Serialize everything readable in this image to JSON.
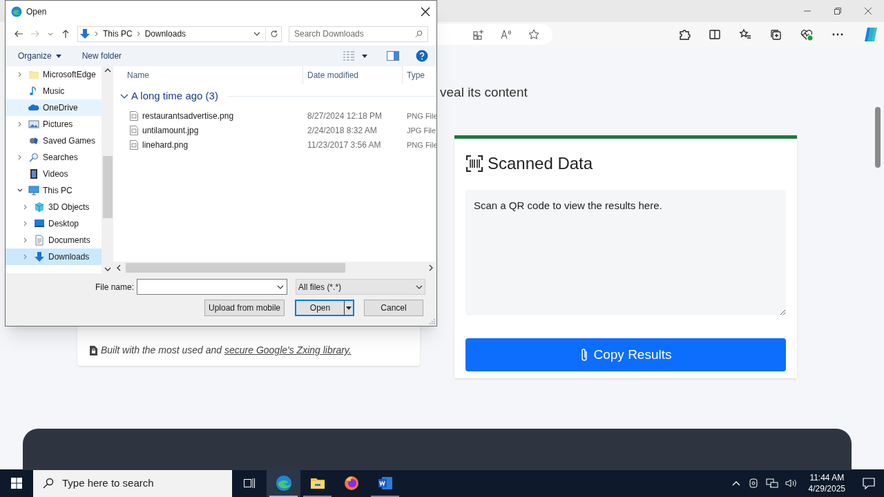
{
  "page": {
    "heading_fragment": "veal its content",
    "footer_note": {
      "text": "Built with the most used and ",
      "link": "secure Google's Zxing library."
    },
    "scanned_card": {
      "title": "Scanned Data",
      "results": {
        "placeholder": "Scan a QR code to view the results here."
      },
      "button": "Copy Results"
    }
  },
  "dialog": {
    "title": "Open",
    "address": [
      "This PC",
      "Downloads"
    ],
    "search": {
      "placeholder": "Search Downloads"
    },
    "toolbar": [
      "Organize",
      "New folder"
    ],
    "nav": [
      {
        "label": "MicrosoftEdge",
        "kind": "folder",
        "expandable": true,
        "selected": false,
        "hovered": false
      },
      {
        "label": "Music",
        "kind": "music",
        "expandable": false,
        "selected": false,
        "hovered": false
      },
      {
        "label": "OneDrive",
        "kind": "cloud",
        "expandable": false,
        "selected": false,
        "hovered": true
      },
      {
        "label": "Pictures",
        "kind": "pictures",
        "expandable": true,
        "selected": false,
        "hovered": false
      },
      {
        "label": "Saved Games",
        "kind": "games",
        "expandable": false,
        "selected": false,
        "hovered": false
      },
      {
        "label": "Searches",
        "kind": "search",
        "expandable": true,
        "selected": false,
        "hovered": false
      },
      {
        "label": "Videos",
        "kind": "videos",
        "expandable": false,
        "selected": false,
        "hovered": false
      },
      {
        "label": "This PC",
        "kind": "pc",
        "expandable": true,
        "expanded": true,
        "selected": false,
        "hovered": false,
        "children": [
          {
            "label": "3D Objects",
            "kind": "cube",
            "expandable": true,
            "selected": false,
            "hovered": false
          },
          {
            "label": "Desktop",
            "kind": "desktop",
            "expandable": true,
            "selected": false,
            "hovered": false
          },
          {
            "label": "Documents",
            "kind": "documents",
            "expandable": true,
            "selected": false,
            "hovered": false
          },
          {
            "label": "Downloads",
            "kind": "downloads",
            "expandable": true,
            "selected": true,
            "hovered": false
          }
        ]
      }
    ],
    "columns": [
      "Name",
      "Date modified",
      "Type"
    ],
    "group": {
      "label": "A long time ago (3)",
      "expanded": true
    },
    "files": [
      {
        "name": "restaurantsadvertise.png",
        "date": "8/27/2024 12:18 PM",
        "type": "PNG File"
      },
      {
        "name": "untilamount.jpg",
        "date": "2/24/2018 8:32 AM",
        "type": "JPG File"
      },
      {
        "name": "linehard.png",
        "date": "11/23/2017 3:56 AM",
        "type": "PNG File"
      }
    ],
    "file_name_label": "File name:",
    "filter": "All files (*.*)",
    "buttons": [
      "Upload from mobile",
      "Open",
      "Cancel"
    ]
  },
  "taskbar": {
    "search": {
      "placeholder": "Type here to search"
    },
    "apps": [
      {
        "kind": "edge",
        "selected": true,
        "running": true
      },
      {
        "kind": "explorer",
        "selected": false,
        "running": true
      },
      {
        "kind": "firefox",
        "selected": false,
        "running": false
      },
      {
        "kind": "word",
        "selected": false,
        "running": true
      }
    ],
    "time": "11:44 AM",
    "date": "4/29/2025"
  }
}
